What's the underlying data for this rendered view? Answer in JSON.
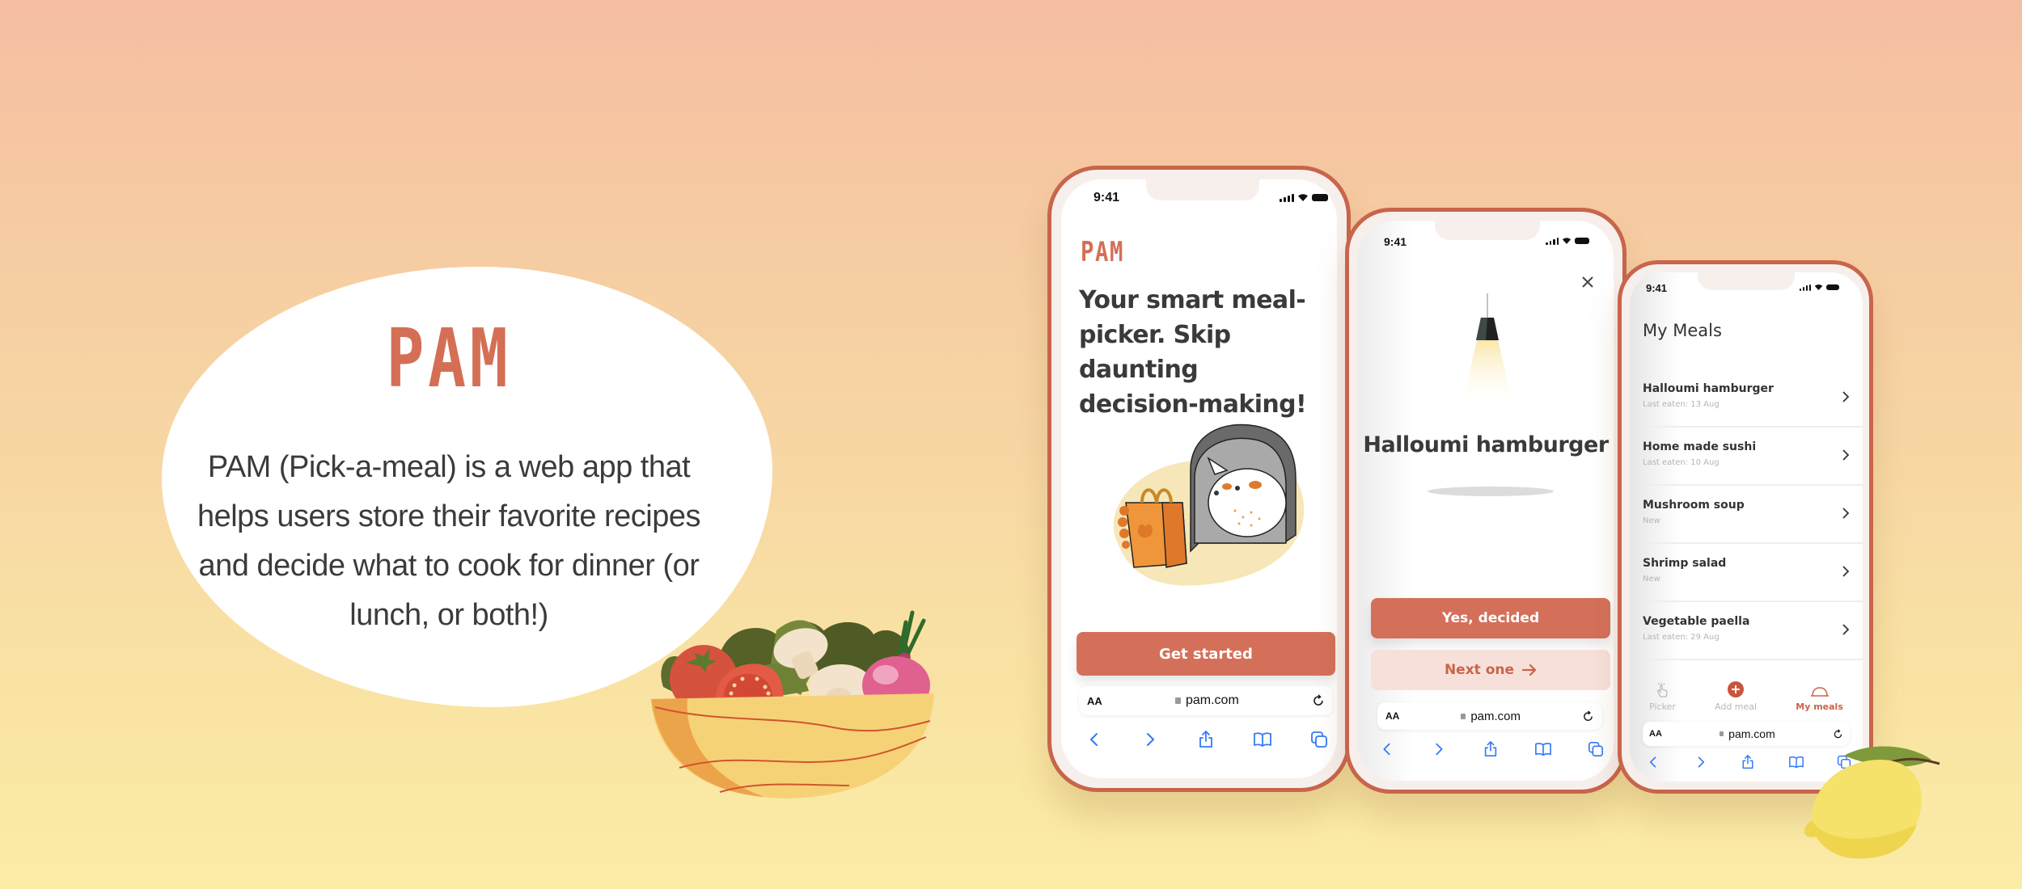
{
  "intro": {
    "brand": "PAM",
    "description": "PAM (Pick-a-meal) is a web app that helps users store their favorite recipes and decide what to cook for dinner (or lunch, or both!)"
  },
  "colors": {
    "accent": "#d4705a",
    "frame": "#c8654a",
    "secondary_bg": "#f8e0da",
    "bg_top": "#f5bea2",
    "bg_bottom": "#fbeca6",
    "link_blue": "#3478f6"
  },
  "status_bar": {
    "time": "9:41"
  },
  "browser": {
    "aa_label": "AA",
    "url": "pam.com",
    "toolbar_icons": [
      "back-icon",
      "forward-icon",
      "share-icon",
      "bookmarks-icon",
      "tabs-icon"
    ]
  },
  "phone1": {
    "logo": "PAM",
    "headline": "Your smart meal-picker. Skip daunting decision-making!",
    "headline_lines": [
      "Your smart meal-",
      "picker. Skip daunting",
      "decision-making!"
    ],
    "illustration": "cat-with-shopping-bag",
    "cta_label": "Get started"
  },
  "phone2": {
    "close_icon": "close-icon",
    "illustration": "hanging-lamp",
    "meal_title": "Halloumi hamburger",
    "primary_label": "Yes, decided",
    "secondary_label": "Next one",
    "secondary_icon": "arrow-right-icon"
  },
  "phone3": {
    "title": "My Meals",
    "meals": [
      {
        "name": "Halloumi hamburger",
        "sub": "Last eaten: 13 Aug"
      },
      {
        "name": "Home made sushi",
        "sub": "Last eaten: 10 Aug"
      },
      {
        "name": "Mushroom soup",
        "sub": "New"
      },
      {
        "name": "Shrimp salad",
        "sub": "New"
      },
      {
        "name": "Vegetable paella",
        "sub": "Last eaten: 29 Aug"
      }
    ],
    "tabs": [
      {
        "label": "Picker",
        "icon": "tap-hand-icon",
        "active": false
      },
      {
        "label": "Add meal",
        "icon": "plus-circle-icon",
        "active": false
      },
      {
        "label": "My meals",
        "icon": "cloche-icon",
        "active": true
      }
    ]
  },
  "decorations": [
    "salad-bowl",
    "lemon"
  ]
}
